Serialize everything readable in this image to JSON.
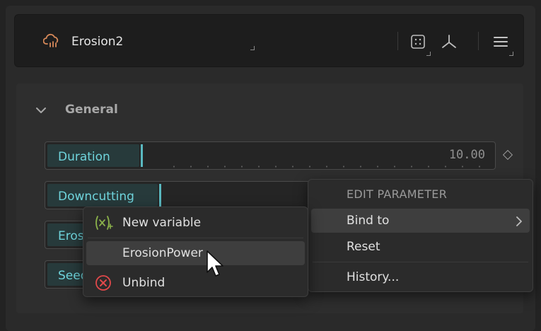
{
  "node": {
    "title": "Erosion2",
    "icon": "cloud-erosion-icon",
    "accent_color": "#d98a5a"
  },
  "header_buttons": [
    {
      "name": "inspect-icon"
    },
    {
      "name": "graph-icon"
    },
    {
      "name": "hamburger-menu-icon"
    }
  ],
  "section": {
    "title": "General",
    "expanded": true
  },
  "parameters": [
    {
      "label": "Duration",
      "value": "10.00"
    },
    {
      "label": "Downcutting",
      "value": ""
    },
    {
      "label": "Eros",
      "value": ""
    },
    {
      "label": "Seed",
      "value": ""
    }
  ],
  "context_menu": {
    "heading": "EDIT PARAMETER",
    "items": [
      {
        "label": "Bind to",
        "highlighted": true,
        "has_submenu": true
      },
      {
        "label": "Reset"
      },
      {
        "label": "History..."
      }
    ]
  },
  "submenu": {
    "items": [
      {
        "label": "New variable",
        "icon": "new-variable-icon",
        "icon_color": "#8ab04a"
      },
      {
        "label": "ErosionPower",
        "highlighted": true
      },
      {
        "label": "Unbind",
        "icon": "unbind-icon",
        "icon_color": "#e0484a"
      }
    ]
  },
  "colors": {
    "param_label": "#6fd4dc",
    "param_label_bg": "#273a3b",
    "background": "#232323"
  }
}
